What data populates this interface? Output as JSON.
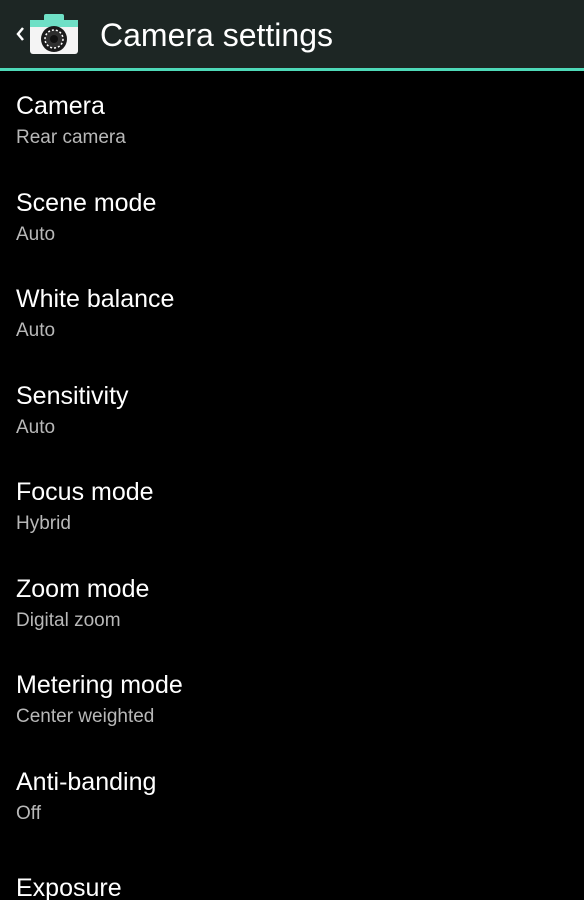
{
  "header": {
    "title": "Camera settings",
    "icons": [
      "back-chevron-icon",
      "camera-app-icon"
    ],
    "colors": {
      "bar": "#1d2624",
      "accent": "#4ed9b8"
    }
  },
  "preferences": [
    {
      "title": "Camera",
      "summary": "Rear camera"
    },
    {
      "title": "Scene mode",
      "summary": "Auto"
    },
    {
      "title": "White balance",
      "summary": "Auto"
    },
    {
      "title": "Sensitivity",
      "summary": "Auto"
    },
    {
      "title": "Focus mode",
      "summary": "Hybrid"
    },
    {
      "title": "Zoom mode",
      "summary": "Digital zoom"
    },
    {
      "title": "Metering mode",
      "summary": "Center weighted"
    },
    {
      "title": "Anti-banding",
      "summary": "Off"
    },
    {
      "title": "Exposure",
      "summary": ""
    }
  ]
}
